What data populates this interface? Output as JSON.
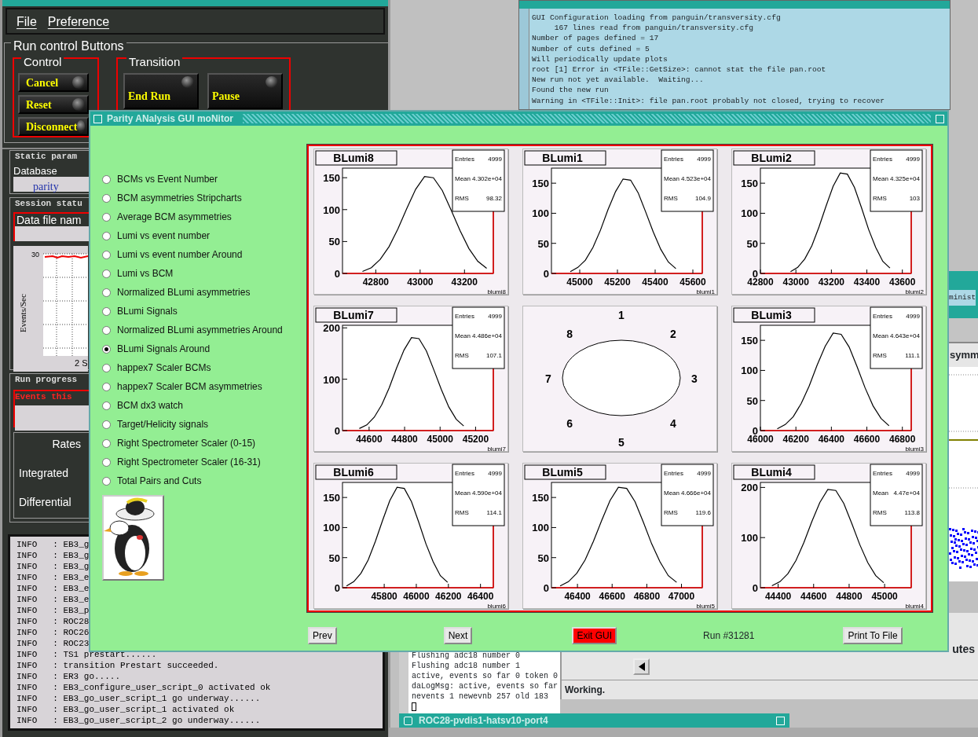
{
  "run_control": {
    "menu": [
      "File",
      "Preference"
    ],
    "group_title": "Run control Buttons",
    "control": {
      "title": "Control",
      "buttons": [
        "Cancel",
        "Reset",
        "Disconnect"
      ]
    },
    "transition": {
      "title": "Transition",
      "buttons": [
        "End Run",
        "Pause"
      ]
    },
    "static_params": {
      "title": "Static param",
      "database_label": "Database",
      "database": "parity"
    },
    "session_status": {
      "title": "Session statu",
      "data_file_label": "Data file nam",
      "rate_chart": {
        "y_tick": "30",
        "ylabel": "Events/Sec",
        "xlabel": "2 S"
      }
    },
    "run_progress": {
      "title": "Run progress",
      "events_label": "Events this",
      "rates_label": "Rates",
      "rows": [
        "Integrated",
        "Differential"
      ]
    },
    "log": [
      "INFO   : EB3_g",
      "INFO   : EB3_g",
      "INFO   : EB3_g",
      "INFO   : EB3_e",
      "INFO   : EB3_e",
      "INFO   : EB3_e",
      "INFO   : EB3_p",
      "INFO   : ROC28",
      "INFO   : ROC26",
      "INFO   : ROC23",
      "INFO   : TS1 prestart......",
      "INFO   : transition Prestart succeeded.",
      "INFO   : ER3 go.....",
      "INFO   : EB3_configure_user_script_0 activated ok",
      "INFO   : EB3_go_user_script_1 go underway......",
      "INFO   : EB3_go_user_script_1 activated ok",
      "INFO   : EB3_go_user_script_2 go underway......"
    ]
  },
  "xterm": {
    "lines": [
      "GUI Configuration loading from panguin/transversity.cfg",
      "     167 lines read from panguin/transversity.cfg",
      "Number of pages defined = 17",
      "Number of cuts defined = 5",
      "Will periodically update plots",
      "root [1] Error in <TFile::GetSize>: cannot stat the file pan.root",
      "New run not yet available.  Waiting...",
      "Found the new run",
      "Warning in <TFile::Init>: file pan.root probably not closed, trying to recover"
    ]
  },
  "monitor": {
    "title": "Parity ANalysis GUI moNitor",
    "pages": [
      {
        "label": "BCMs vs Event Number",
        "selected": false
      },
      {
        "label": "BCM asymmetries Stripcharts",
        "selected": false
      },
      {
        "label": "Average BCM asymmetries",
        "selected": false
      },
      {
        "label": "Lumi vs event number",
        "selected": false
      },
      {
        "label": "Lumi vs event number Around",
        "selected": false
      },
      {
        "label": "Lumi vs BCM",
        "selected": false
      },
      {
        "label": "Normalized BLumi asymmetries",
        "selected": false
      },
      {
        "label": "BLumi Signals",
        "selected": false
      },
      {
        "label": "Normalized BLumi asymmetries Around",
        "selected": false
      },
      {
        "label": "BLumi Signals Around",
        "selected": true
      },
      {
        "label": "happex7 Scaler BCMs",
        "selected": false
      },
      {
        "label": "happex7 Scaler BCM asymmetries",
        "selected": false
      },
      {
        "label": "BCM dx3 watch",
        "selected": false
      },
      {
        "label": "Target/Helicity signals",
        "selected": false
      },
      {
        "label": "Right Spectrometer Scaler (0-15)",
        "selected": false
      },
      {
        "label": "Right Spectrometer Scaler (16-31)",
        "selected": false
      },
      {
        "label": "Total Pairs and Cuts",
        "selected": false
      }
    ],
    "pads": [
      {
        "kind": "histogram",
        "stats": [
          {
            "label": "Entries",
            "value": "4999"
          },
          {
            "label": "Mean",
            "value": "4.302e+04"
          },
          {
            "label": "RMS",
            "value": "98.32"
          }
        ],
        "chart_data": {
          "type": "line",
          "title": "BLumi8",
          "xlabel": "blumi8",
          "x": [
            42740,
            42780,
            42820,
            42860,
            42900,
            42940,
            42980,
            43020,
            43060,
            43100,
            43140,
            43180,
            43220,
            43260,
            43300
          ],
          "series": [
            {
              "color": "#000000",
              "values": [
                3,
                9,
                22,
                42,
                70,
                102,
                132,
                152,
                150,
                130,
                99,
                67,
                39,
                19,
                8
              ]
            }
          ],
          "xlim": [
            42650,
            43330
          ],
          "ylim": [
            0,
            165
          ],
          "xticks": [
            42800,
            43000,
            43200
          ],
          "yticks": [
            0,
            50,
            100,
            150
          ]
        }
      },
      {
        "kind": "histogram",
        "stats": [
          {
            "label": "Entries",
            "value": "4999"
          },
          {
            "label": "Mean",
            "value": "4.523e+04"
          },
          {
            "label": "RMS",
            "value": "104.9"
          }
        ],
        "chart_data": {
          "type": "line",
          "title": "BLumi1",
          "xlabel": "blumi1",
          "x": [
            44950,
            44990,
            45030,
            45070,
            45110,
            45150,
            45190,
            45230,
            45270,
            45310,
            45350,
            45390,
            45430,
            45470,
            45510
          ],
          "series": [
            {
              "color": "#000000",
              "values": [
                3,
                10,
                22,
                43,
                72,
                106,
                136,
                157,
                155,
                134,
                102,
                69,
                40,
                19,
                8
              ]
            }
          ],
          "xlim": [
            44850,
            45650
          ],
          "ylim": [
            0,
            175
          ],
          "xticks": [
            45000,
            45200,
            45400,
            45600
          ],
          "yticks": [
            0,
            50,
            100,
            150
          ]
        }
      },
      {
        "kind": "histogram",
        "stats": [
          {
            "label": "Entries",
            "value": "4999"
          },
          {
            "label": "Mean",
            "value": "4.325e+04"
          },
          {
            "label": "RMS",
            "value": "103"
          }
        ],
        "chart_data": {
          "type": "line",
          "title": "BLumi2",
          "xlabel": "blumi2",
          "x": [
            42970,
            43010,
            43050,
            43090,
            43130,
            43170,
            43210,
            43250,
            43290,
            43330,
            43370,
            43410,
            43450,
            43490,
            43530
          ],
          "series": [
            {
              "color": "#000000",
              "values": [
                3,
                10,
                24,
                46,
                77,
                112,
                145,
                167,
                165,
                143,
                109,
                73,
                43,
                20,
                9
              ]
            }
          ],
          "xlim": [
            42800,
            43650
          ],
          "ylim": [
            0,
            175
          ],
          "xticks": [
            42800,
            43000,
            43200,
            43400,
            43600
          ],
          "yticks": [
            0,
            50,
            100,
            150
          ]
        }
      },
      {
        "kind": "histogram",
        "stats": [
          {
            "label": "Entries",
            "value": "4999"
          },
          {
            "label": "Mean",
            "value": "4.486e+04"
          },
          {
            "label": "RMS",
            "value": "107.1"
          }
        ],
        "chart_data": {
          "type": "line",
          "title": "BLumi7",
          "xlabel": "blumi7",
          "x": [
            44545,
            44587,
            44629,
            44671,
            44713,
            44755,
            44797,
            44839,
            44881,
            44923,
            44965,
            45007,
            45049,
            45091,
            45133
          ],
          "series": [
            {
              "color": "#000000",
              "values": [
                4,
                11,
                26,
                50,
                83,
                122,
                157,
                181,
                179,
                155,
                118,
                80,
                46,
                22,
                9
              ]
            }
          ],
          "xlim": [
            44450,
            45300
          ],
          "ylim": [
            0,
            205
          ],
          "xticks": [
            44600,
            44800,
            45000,
            45200
          ],
          "yticks": [
            0,
            100,
            200
          ]
        }
      },
      {
        "kind": "diagram",
        "labels": [
          "1",
          "2",
          "3",
          "4",
          "5",
          "6",
          "7",
          "8"
        ]
      },
      {
        "kind": "histogram",
        "stats": [
          {
            "label": "Entries",
            "value": "4999"
          },
          {
            "label": "Mean",
            "value": "4.643e+04"
          },
          {
            "label": "RMS",
            "value": "111.1"
          }
        ],
        "chart_data": {
          "type": "line",
          "title": "BLumi3",
          "xlabel": "blumi3",
          "x": [
            46095,
            46140,
            46185,
            46230,
            46275,
            46320,
            46365,
            46410,
            46455,
            46500,
            46545,
            46590,
            46635,
            46680,
            46725
          ],
          "series": [
            {
              "color": "#000000",
              "values": [
                3,
                10,
                23,
                45,
                74,
                109,
                140,
                162,
                160,
                139,
                106,
                71,
                41,
                20,
                8
              ]
            }
          ],
          "xlim": [
            46000,
            46850
          ],
          "ylim": [
            0,
            175
          ],
          "xticks": [
            46000,
            46200,
            46400,
            46600,
            46800
          ],
          "yticks": [
            0,
            50,
            100,
            150
          ]
        }
      },
      {
        "kind": "histogram",
        "stats": [
          {
            "label": "Entries",
            "value": "4999"
          },
          {
            "label": "Mean",
            "value": "4.590e+04"
          },
          {
            "label": "RMS",
            "value": "114.1"
          }
        ],
        "chart_data": {
          "type": "line",
          "title": "BLumi6",
          "xlabel": "blumi6",
          "x": [
            45565,
            45610,
            45655,
            45700,
            45745,
            45790,
            45835,
            45880,
            45925,
            45970,
            46015,
            46060,
            46105,
            46150,
            46195
          ],
          "series": [
            {
              "color": "#000000",
              "values": [
                3,
                10,
                24,
                46,
                77,
                112,
                145,
                167,
                165,
                143,
                109,
                73,
                43,
                20,
                9
              ]
            }
          ],
          "xlim": [
            45540,
            46480
          ],
          "ylim": [
            0,
            175
          ],
          "xticks": [
            45800,
            46000,
            46200,
            46400
          ],
          "yticks": [
            0,
            50,
            100,
            150
          ]
        }
      },
      {
        "kind": "histogram",
        "stats": [
          {
            "label": "Entries",
            "value": "4999"
          },
          {
            "label": "Mean",
            "value": "4.666e+04"
          },
          {
            "label": "RMS",
            "value": "119.6"
          }
        ],
        "chart_data": {
          "type": "line",
          "title": "BLumi5",
          "xlabel": "blumi5",
          "x": [
            46300,
            46348,
            46396,
            46444,
            46492,
            46540,
            46588,
            46636,
            46684,
            46732,
            46780,
            46828,
            46876,
            46924,
            46972
          ],
          "series": [
            {
              "color": "#000000",
              "values": [
                3,
                10,
                24,
                46,
                77,
                112,
                145,
                167,
                165,
                143,
                109,
                73,
                43,
                20,
                9
              ]
            }
          ],
          "xlim": [
            46250,
            47120
          ],
          "ylim": [
            0,
            175
          ],
          "xticks": [
            46400,
            46600,
            46800,
            47000
          ],
          "yticks": [
            0,
            50,
            100,
            150
          ]
        }
      },
      {
        "kind": "histogram",
        "stats": [
          {
            "label": "Entries",
            "value": "4999"
          },
          {
            "label": "Mean",
            "value": "4.47e+04"
          },
          {
            "label": "RMS",
            "value": "113.8"
          }
        ],
        "chart_data": {
          "type": "line",
          "title": "BLumi4",
          "xlabel": "blumi4",
          "x": [
            44365,
            44410,
            44455,
            44500,
            44545,
            44590,
            44635,
            44680,
            44725,
            44770,
            44815,
            44860,
            44905,
            44950,
            44995
          ],
          "series": [
            {
              "color": "#000000",
              "values": [
                4,
                12,
                28,
                54,
                90,
                132,
                170,
                196,
                194,
                168,
                128,
                86,
                50,
                24,
                10
              ]
            }
          ],
          "xlim": [
            44300,
            45150
          ],
          "ylim": [
            0,
            210
          ],
          "xticks": [
            44400,
            44600,
            44800,
            45000
          ],
          "yticks": [
            0,
            100,
            200
          ]
        }
      }
    ],
    "footer": [
      {
        "kind": "button",
        "label": "Prev"
      },
      {
        "kind": "button",
        "label": "Next"
      },
      {
        "kind": "exit",
        "label": "Exit GUI"
      },
      {
        "kind": "text",
        "label": "Run #31281"
      },
      {
        "kind": "button",
        "label": "Print To File"
      }
    ]
  },
  "side_window": {
    "title": "minist",
    "heading": "symm"
  },
  "daq_terminal": {
    "lines": [
      "Flushing adc18 number 0",
      "Flushing adc18 number 1",
      "active, events so far 0 token 0",
      "daLogMsg: active, events so far",
      "nevents 1 newevnb 257 old 183"
    ]
  },
  "status_panel": {
    "fragment": "utes",
    "status": "Working."
  },
  "roc_window": {
    "title": "ROC28-pvdis1-hatsv10-port4"
  }
}
